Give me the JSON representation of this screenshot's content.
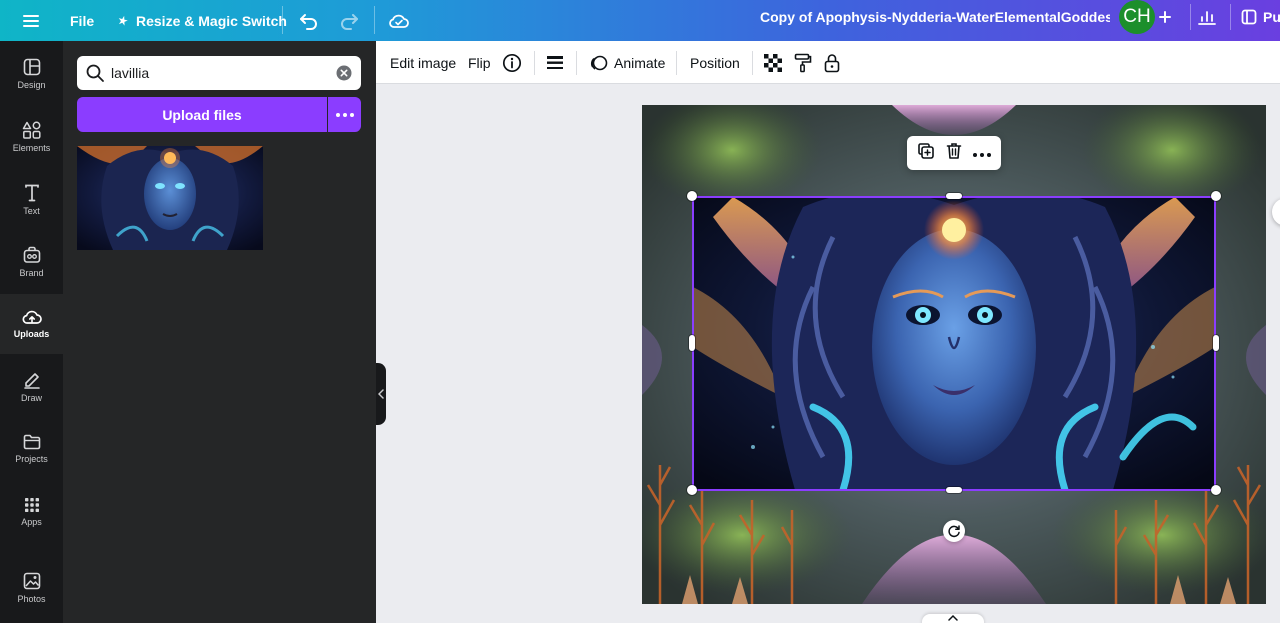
{
  "topbar": {
    "file_label": "File",
    "resize_label": "Resize & Magic Switch",
    "document_title": "Copy of Apophysis-Nydderia-WaterElementalGoddess",
    "avatar_initials": "CH",
    "publish_label": "Pu",
    "icons": [
      "menu-icon",
      "crown-sparkle-icon",
      "undo-icon",
      "redo-icon",
      "cloud-sync-icon",
      "plus-icon",
      "bar-chart-icon",
      "publish-icon"
    ]
  },
  "rail": {
    "items": [
      {
        "label": "Design",
        "icon": "layout-icon"
      },
      {
        "label": "Elements",
        "icon": "shapes-icon"
      },
      {
        "label": "Text",
        "icon": "text-t-icon"
      },
      {
        "label": "Brand",
        "icon": "briefcase-icon"
      },
      {
        "label": "Uploads",
        "icon": "cloud-upload-icon",
        "active": true
      },
      {
        "label": "Draw",
        "icon": "pen-icon"
      },
      {
        "label": "Projects",
        "icon": "folder-icon"
      },
      {
        "label": "Apps",
        "icon": "grid-icon"
      },
      {
        "label": "Photos",
        "icon": "image-icon"
      }
    ]
  },
  "panel": {
    "search_value": "lavillia",
    "upload_label": "Upload files"
  },
  "context_toolbar": {
    "edit_image": "Edit image",
    "flip": "Flip",
    "animate": "Animate",
    "position": "Position"
  },
  "colors": {
    "accent": "#8b3dff",
    "avatar": "#1c8f2b",
    "rail_bg": "#18191b",
    "panel_bg": "#252627"
  }
}
